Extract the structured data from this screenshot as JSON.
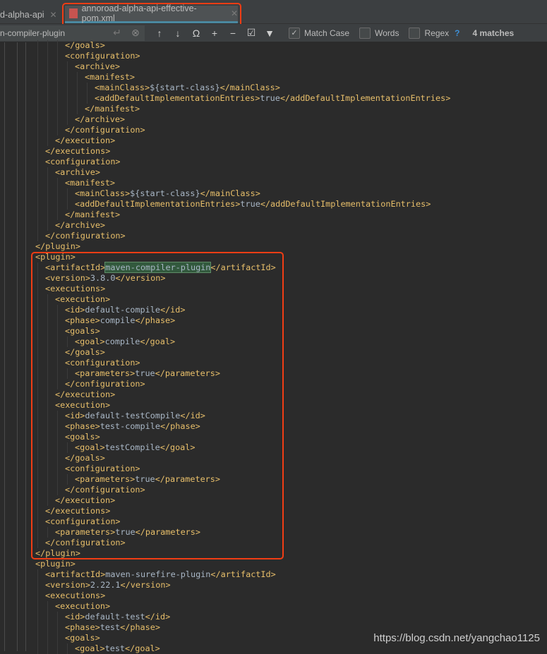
{
  "tabs": [
    {
      "label": "d-alpha-api",
      "active": false
    },
    {
      "label": "annoroad-alpha-api-effective-pom.xml",
      "active": true
    }
  ],
  "find": {
    "query": "n-compiler-plugin",
    "match_case": {
      "label": "Match Case",
      "checked": true
    },
    "words": {
      "label": "Words",
      "checked": false
    },
    "regex": {
      "label": "Regex",
      "checked": false
    },
    "help": "?",
    "matches": "4 matches"
  },
  "colors": {
    "tag": "#e8bf6a",
    "text": "#a9b7c6",
    "background": "#2b2b2b",
    "highlight": "#32593d",
    "annotation": "#f03d14"
  },
  "lines": [
    {
      "i": 3,
      "t": "</goals>"
    },
    {
      "i": 3,
      "t": "<configuration>"
    },
    {
      "i": 4,
      "t": "<archive>"
    },
    {
      "i": 5,
      "t": "<manifest>"
    },
    {
      "i": 6,
      "t": "<mainClass>${start-class}</mainClass>"
    },
    {
      "i": 6,
      "t": "<addDefaultImplementationEntries>true</addDefaultImplementationEntries>"
    },
    {
      "i": 5,
      "t": "</manifest>"
    },
    {
      "i": 4,
      "t": "</archive>"
    },
    {
      "i": 3,
      "t": "</configuration>"
    },
    {
      "i": 2,
      "t": "</execution>"
    },
    {
      "i": 1,
      "t": "</executions>"
    },
    {
      "i": 1,
      "t": "<configuration>"
    },
    {
      "i": 2,
      "t": "<archive>"
    },
    {
      "i": 3,
      "t": "<manifest>"
    },
    {
      "i": 4,
      "t": "<mainClass>${start-class}</mainClass>"
    },
    {
      "i": 4,
      "t": "<addDefaultImplementationEntries>true</addDefaultImplementationEntries>"
    },
    {
      "i": 3,
      "t": "</manifest>"
    },
    {
      "i": 2,
      "t": "</archive>"
    },
    {
      "i": 1,
      "t": "</configuration>"
    },
    {
      "i": 0,
      "t": "</plugin>"
    },
    {
      "i": 0,
      "t": "<plugin>"
    },
    {
      "i": 1,
      "t": "<artifactId>maven-compiler-plugin</artifactId>",
      "hl": "maven-compiler-plugin"
    },
    {
      "i": 1,
      "t": "<version>3.8.0</version>"
    },
    {
      "i": 1,
      "t": "<executions>"
    },
    {
      "i": 2,
      "t": "<execution>"
    },
    {
      "i": 3,
      "t": "<id>default-compile</id>"
    },
    {
      "i": 3,
      "t": "<phase>compile</phase>"
    },
    {
      "i": 3,
      "t": "<goals>"
    },
    {
      "i": 4,
      "t": "<goal>compile</goal>"
    },
    {
      "i": 3,
      "t": "</goals>"
    },
    {
      "i": 3,
      "t": "<configuration>"
    },
    {
      "i": 4,
      "t": "<parameters>true</parameters>"
    },
    {
      "i": 3,
      "t": "</configuration>"
    },
    {
      "i": 2,
      "t": "</execution>"
    },
    {
      "i": 2,
      "t": "<execution>"
    },
    {
      "i": 3,
      "t": "<id>default-testCompile</id>"
    },
    {
      "i": 3,
      "t": "<phase>test-compile</phase>"
    },
    {
      "i": 3,
      "t": "<goals>"
    },
    {
      "i": 4,
      "t": "<goal>testCompile</goal>"
    },
    {
      "i": 3,
      "t": "</goals>"
    },
    {
      "i": 3,
      "t": "<configuration>"
    },
    {
      "i": 4,
      "t": "<parameters>true</parameters>"
    },
    {
      "i": 3,
      "t": "</configuration>"
    },
    {
      "i": 2,
      "t": "</execution>"
    },
    {
      "i": 1,
      "t": "</executions>"
    },
    {
      "i": 1,
      "t": "<configuration>"
    },
    {
      "i": 2,
      "t": "<parameters>true</parameters>"
    },
    {
      "i": 1,
      "t": "</configuration>"
    },
    {
      "i": 0,
      "t": "</plugin>"
    },
    {
      "i": 0,
      "t": "<plugin>"
    },
    {
      "i": 1,
      "t": "<artifactId>maven-surefire-plugin</artifactId>"
    },
    {
      "i": 1,
      "t": "<version>2.22.1</version>"
    },
    {
      "i": 1,
      "t": "<executions>"
    },
    {
      "i": 2,
      "t": "<execution>"
    },
    {
      "i": 3,
      "t": "<id>default-test</id>"
    },
    {
      "i": 3,
      "t": "<phase>test</phase>"
    },
    {
      "i": 3,
      "t": "<goals>"
    },
    {
      "i": 4,
      "t": "<goal>test</goal>"
    }
  ],
  "watermark": "https://blog.csdn.net/yangchao1125"
}
